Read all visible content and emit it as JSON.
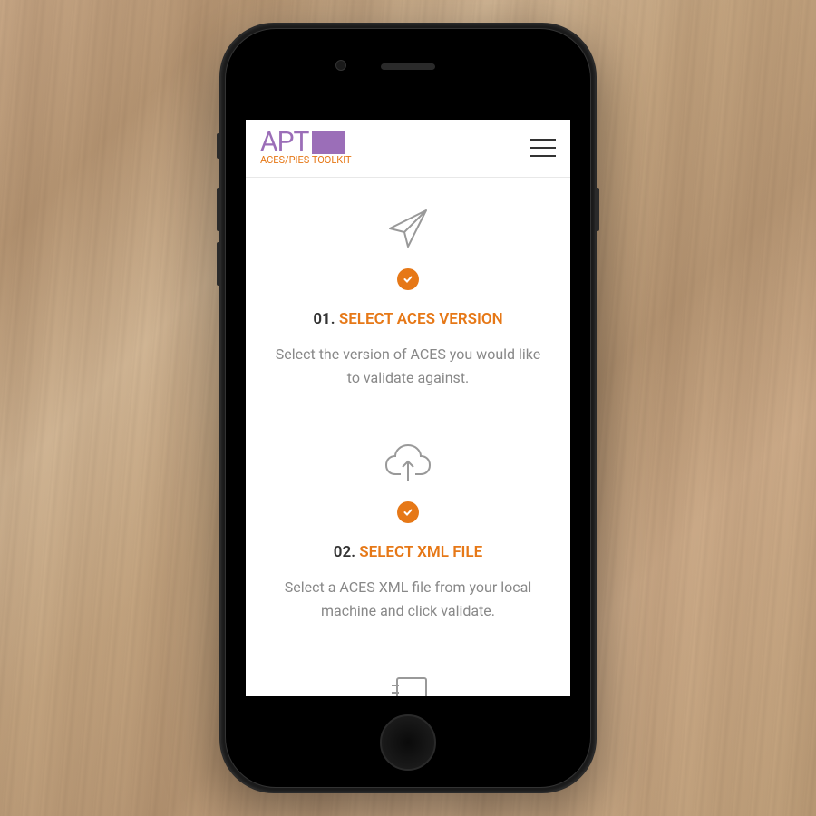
{
  "header": {
    "logo_text": "APT",
    "logo_subtitle": "ACES/PIES TOOLKIT"
  },
  "steps": [
    {
      "number": "01.",
      "label": "SELECT ACES VERSION",
      "description": "Select the version of ACES you would like to validate against."
    },
    {
      "number": "02.",
      "label": "SELECT XML FILE",
      "description": "Select a ACES XML file from your local machine and click validate."
    }
  ]
}
